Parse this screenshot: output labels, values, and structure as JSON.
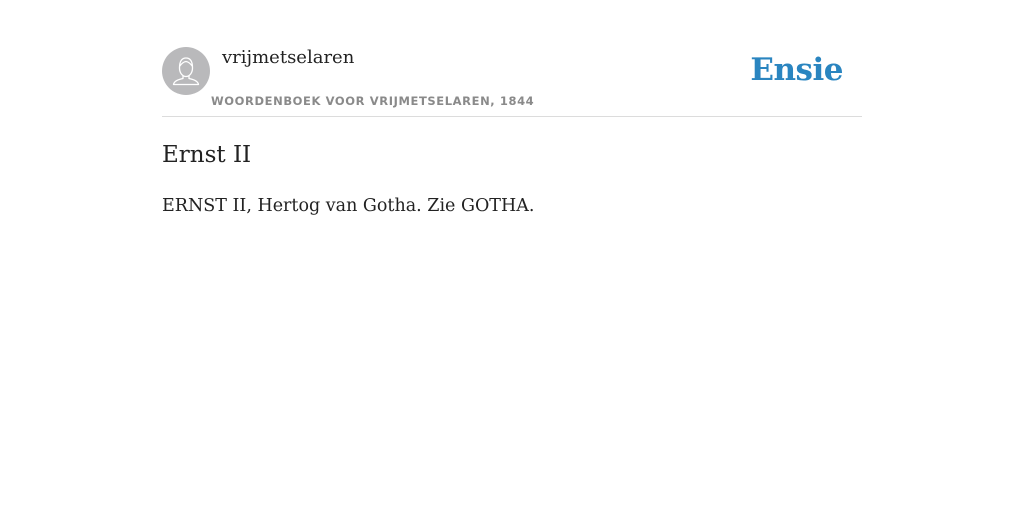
{
  "header": {
    "author": "vrijmetselaren",
    "source": "WOORDENBOEK VOOR VRIJMETSELAREN, 1844",
    "logo": "Ensie",
    "avatar_icon": "user-silhouette-icon"
  },
  "article": {
    "title": "Ernst II",
    "body": "ERNST II, Hertog van Gotha. Zie GOTHA."
  },
  "colors": {
    "accent": "#2a85c0",
    "avatar_bg": "#b9b9bb",
    "source_text": "#8a8a8a",
    "divider": "#dcdcdc"
  }
}
